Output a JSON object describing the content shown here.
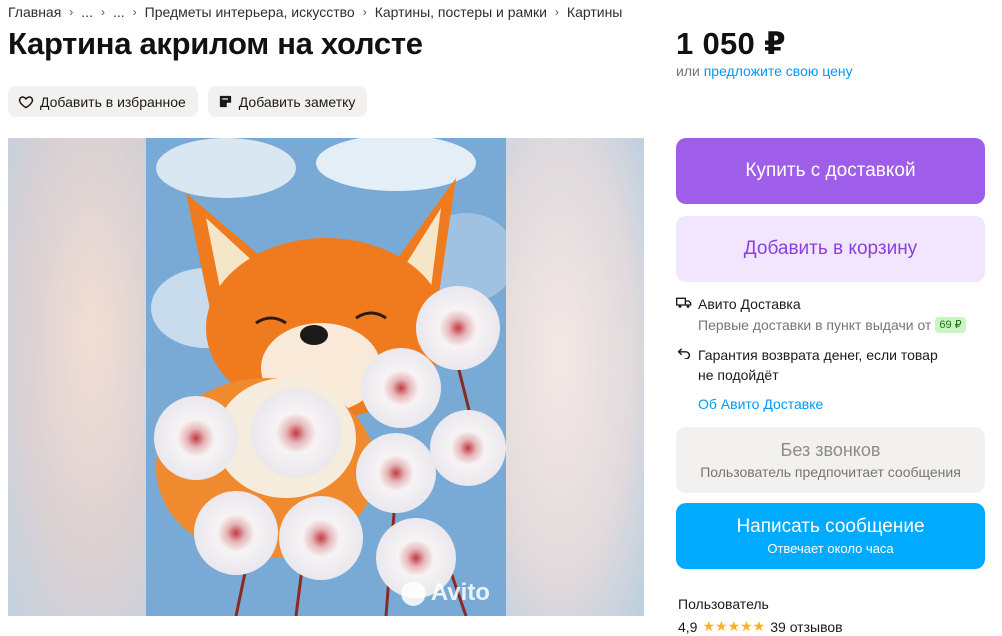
{
  "breadcrumb": {
    "items": [
      "Главная",
      "...",
      "...",
      "Предметы интерьера, искусство",
      "Картины, постеры и рамки",
      "Картины"
    ]
  },
  "listing": {
    "title": "Картина акрилом на холсте",
    "price": "1 050 ₽",
    "offer_prefix": "или",
    "offer_link": "предложите свою цену"
  },
  "actions": {
    "favorite": "Добавить в избранное",
    "note": "Добавить заметку"
  },
  "gallery": {
    "watermark": "Avito"
  },
  "buttons": {
    "buy": "Купить с доставкой",
    "cart": "Добавить в корзину"
  },
  "delivery": {
    "title": "Авито Доставка",
    "subtitle": "Первые доставки в пункт выдачи от",
    "badge": "69 ₽",
    "guarantee_line1": "Гарантия возврата денег, если товар",
    "guarantee_line2": "не подойдёт",
    "link": "Об Авито Доставке"
  },
  "no_calls": {
    "title": "Без звонков",
    "subtitle": "Пользователь предпочитает сообщения"
  },
  "message": {
    "label": "Написать сообщение",
    "sub": "Отвечает около часа"
  },
  "seller": {
    "name": "Пользователь",
    "rating": "4,9",
    "stars": "★★★★★",
    "reviews": "39 отзывов"
  },
  "colors": {
    "buy_bg": "#9f5ee9",
    "cart_bg": "#f1e6fd",
    "message_bg": "#00aaff",
    "link": "#0099f7",
    "star": "#ffb021"
  }
}
